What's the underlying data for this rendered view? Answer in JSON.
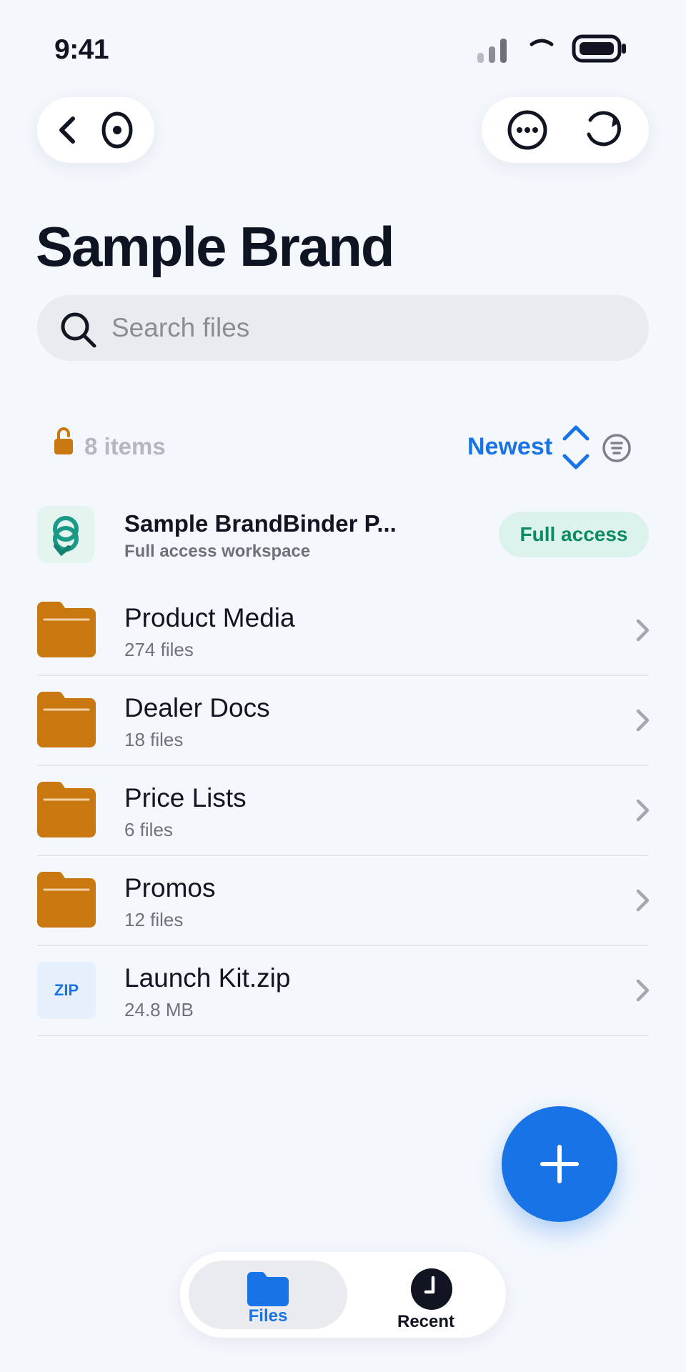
{
  "status_bar": {
    "time": "9:41"
  },
  "nav": {
    "back_icon": "chevron-left-icon",
    "visibility_icon": "eye-icon",
    "more_icon": "ellipsis-circle-icon",
    "refresh_icon": "refresh-icon"
  },
  "page": {
    "title": "Sample Brand"
  },
  "search": {
    "placeholder": "Search files",
    "value": ""
  },
  "meta": {
    "items_count": "8 items",
    "sort_label": "Newest"
  },
  "workspace": {
    "name": "Sample BrandBinder P...",
    "subtitle": "Full access workspace",
    "badge": "Full access"
  },
  "files": [
    {
      "name": "Product Media",
      "meta": "274 files",
      "kind": "folder"
    },
    {
      "name": "Dealer Docs",
      "meta": "18 files",
      "kind": "folder"
    },
    {
      "name": "Price Lists",
      "meta": "6 files",
      "kind": "folder"
    },
    {
      "name": "Promos",
      "meta": "12 files",
      "kind": "folder"
    },
    {
      "name": "Launch Kit.zip",
      "meta": "24.8 MB",
      "kind": "zip",
      "thumb_label": "ZIP"
    }
  ],
  "tabs": [
    {
      "label": "Files",
      "icon": "folder-icon",
      "active": true
    },
    {
      "label": "Recent",
      "icon": "clock-icon",
      "active": false
    }
  ],
  "colors": {
    "accent": "#1873e6",
    "folder": "#c8780f",
    "badge_text": "#0c8a66",
    "badge_bg": "#dcf2ec",
    "background": "#f4f8fd"
  }
}
